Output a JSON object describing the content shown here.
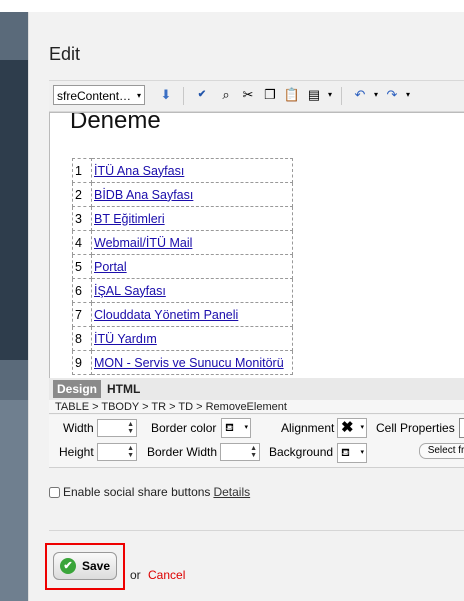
{
  "dialog": {
    "title": "Edit"
  },
  "toolbar": {
    "style_select": "sfreContent…",
    "icons": [
      "spellcheck-icon",
      "find-icon",
      "cut-icon",
      "copy-icon",
      "paste-icon",
      "paste-options-icon",
      "undo-icon",
      "redo-icon"
    ]
  },
  "editor": {
    "heading": "Deneme",
    "rows": [
      {
        "num": "1",
        "text": "İTÜ Ana Sayfası"
      },
      {
        "num": "2",
        "text": "BİDB Ana Sayfası"
      },
      {
        "num": "3",
        "text": "BT Eğitimleri"
      },
      {
        "num": "4",
        "text": "Webmail/İTÜ Mail"
      },
      {
        "num": "5",
        "text": "Portal"
      },
      {
        "num": "6",
        "text": "İŞAL Sayfası"
      },
      {
        "num": "7",
        "text": "Clouddata Yönetim Paneli"
      },
      {
        "num": "8",
        "text": "İTÜ Yardım"
      },
      {
        "num": "9",
        "text": "MON - Servis ve Sunucu Monitörü"
      }
    ]
  },
  "modes": {
    "design": "Design",
    "html": "HTML"
  },
  "path": "TABLE > TBODY > TR > TD > RemoveElement",
  "props": {
    "width": "Width",
    "height": "Height",
    "border_color": "Border color",
    "border_width": "Border Width",
    "alignment": "Alignment",
    "background": "Background",
    "cell_properties": "Cell Properties",
    "select_from": "Select from"
  },
  "social": {
    "label": "Enable social share buttons",
    "details": "Details"
  },
  "actions": {
    "save": "Save",
    "or": "or",
    "cancel": "Cancel"
  },
  "colors": {
    "cancel": "#dd0000",
    "highlight": "#ee0000",
    "link": "#1a0dab",
    "check": "#3aa53a"
  }
}
